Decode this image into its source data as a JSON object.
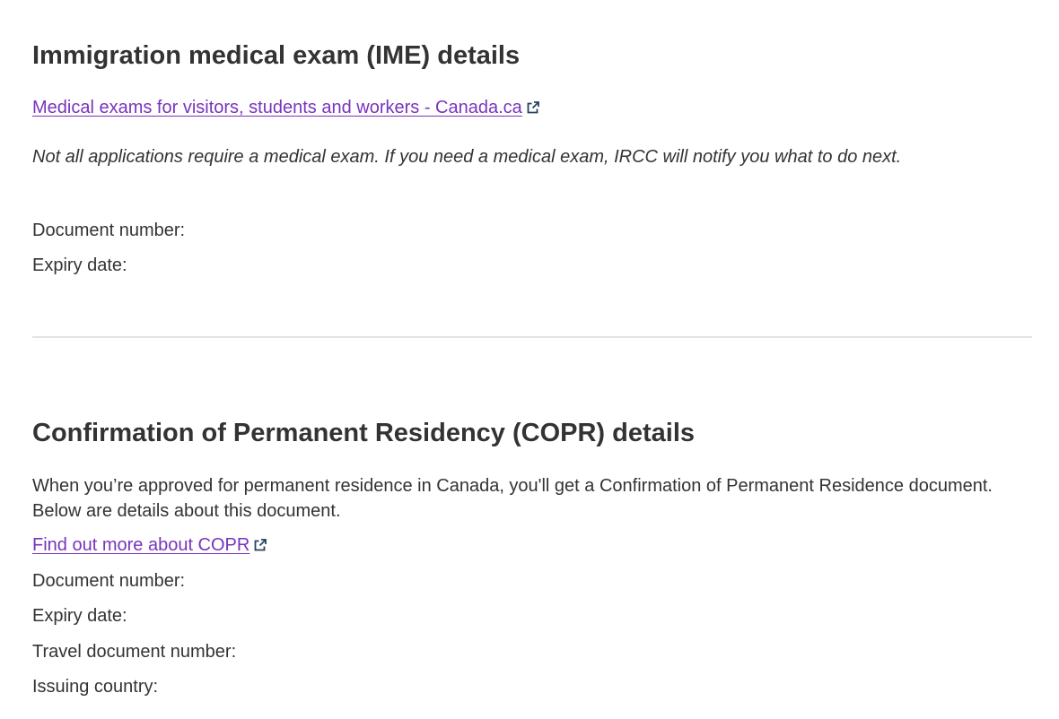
{
  "ime": {
    "heading": "Immigration medical exam (IME) details",
    "link_text": "Medical exams for visitors, students and workers - Canada.ca",
    "link_icon": "external-link-icon",
    "note": "Not all applications require a medical exam. If you need a medical exam, IRCC will notify you what to do next.",
    "fields": {
      "document_number_label": "Document number:",
      "expiry_date_label": "Expiry date:"
    }
  },
  "copr": {
    "heading": "Confirmation of Permanent Residency (COPR) details",
    "description": "When you’re approved for permanent residence in Canada, you'll get a Confirmation of Permanent Residence document. Below are details about this document.",
    "link_text": "Find out more about COPR",
    "link_icon": "external-link-icon",
    "fields": {
      "document_number_label": "Document number:",
      "expiry_date_label": "Expiry date:",
      "travel_document_number_label": "Travel document number:",
      "issuing_country_label": "Issuing country:"
    }
  },
  "colors": {
    "text": "#333333",
    "link": "#7834bc",
    "icon": "#284162",
    "divider": "#e3e3e3"
  }
}
